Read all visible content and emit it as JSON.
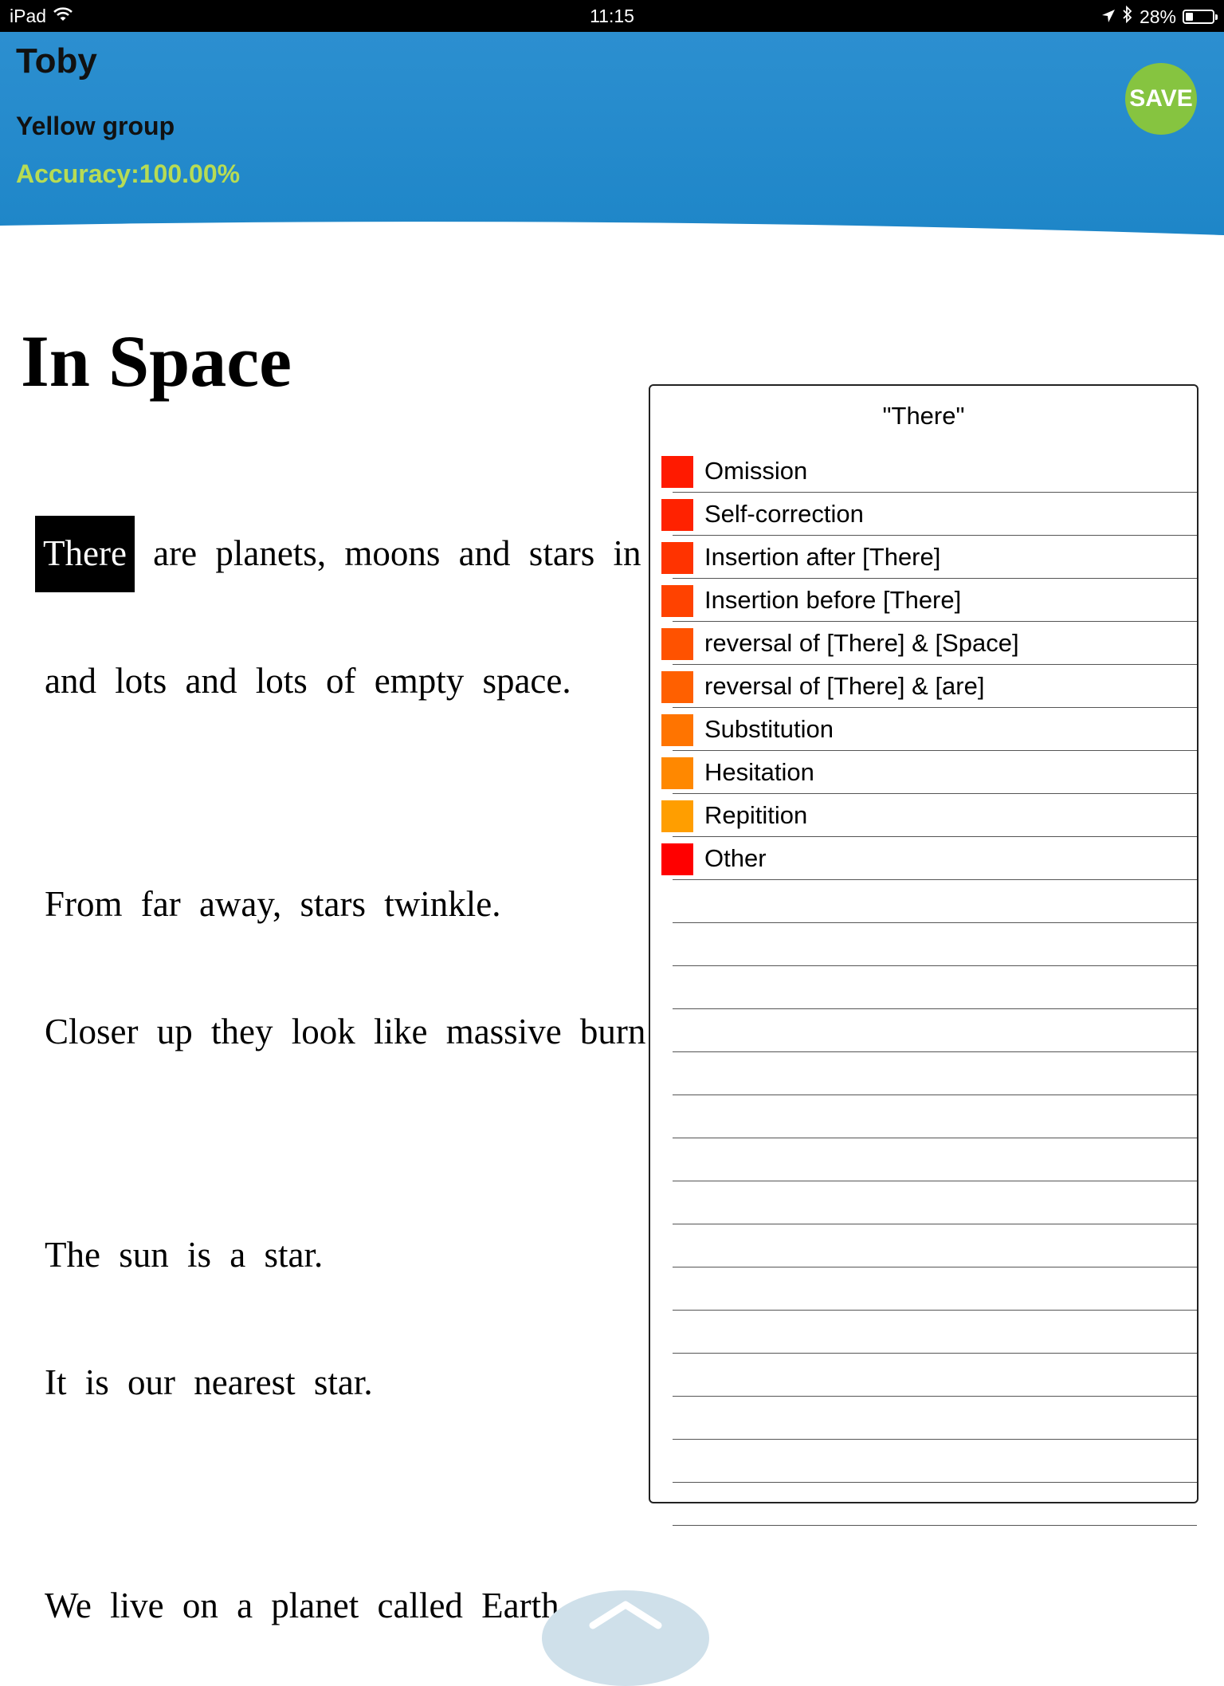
{
  "status_bar": {
    "device": "iPad",
    "time": "11:15",
    "battery": "28%"
  },
  "header": {
    "student_name": "Toby",
    "group": "Yellow group",
    "accuracy": "Accuracy:100.00%",
    "save_label": "SAVE"
  },
  "book": {
    "title": "In Space",
    "lines": {
      "l1_word": "There",
      "l1_rest": "are planets, moons and stars in",
      "l2": "and lots and lots of empty space.",
      "l3": "From far away, stars twinkle.",
      "l4": "Closer up they look like massive burn",
      "l5": "The sun is a star.",
      "l6": "It is our nearest star.",
      "l7": "We live on a planet called Earth"
    }
  },
  "popup": {
    "title": "\"There\"",
    "options": [
      {
        "label": "Omission",
        "color": "#ff1a00"
      },
      {
        "label": "Self-correction",
        "color": "#ff2200"
      },
      {
        "label": "Insertion after [There]",
        "color": "#ff3300"
      },
      {
        "label": "Insertion before [There]",
        "color": "#ff4200"
      },
      {
        "label": "reversal of [There] & [Space]",
        "color": "#ff5200"
      },
      {
        "label": "reversal of [There] & [are]",
        "color": "#ff6000"
      },
      {
        "label": "Substitution",
        "color": "#ff7400"
      },
      {
        "label": "Hesitation",
        "color": "#ff8800"
      },
      {
        "label": "Repitition",
        "color": "#ff9e00"
      },
      {
        "label": "Other",
        "color": "#ff0000"
      }
    ]
  }
}
